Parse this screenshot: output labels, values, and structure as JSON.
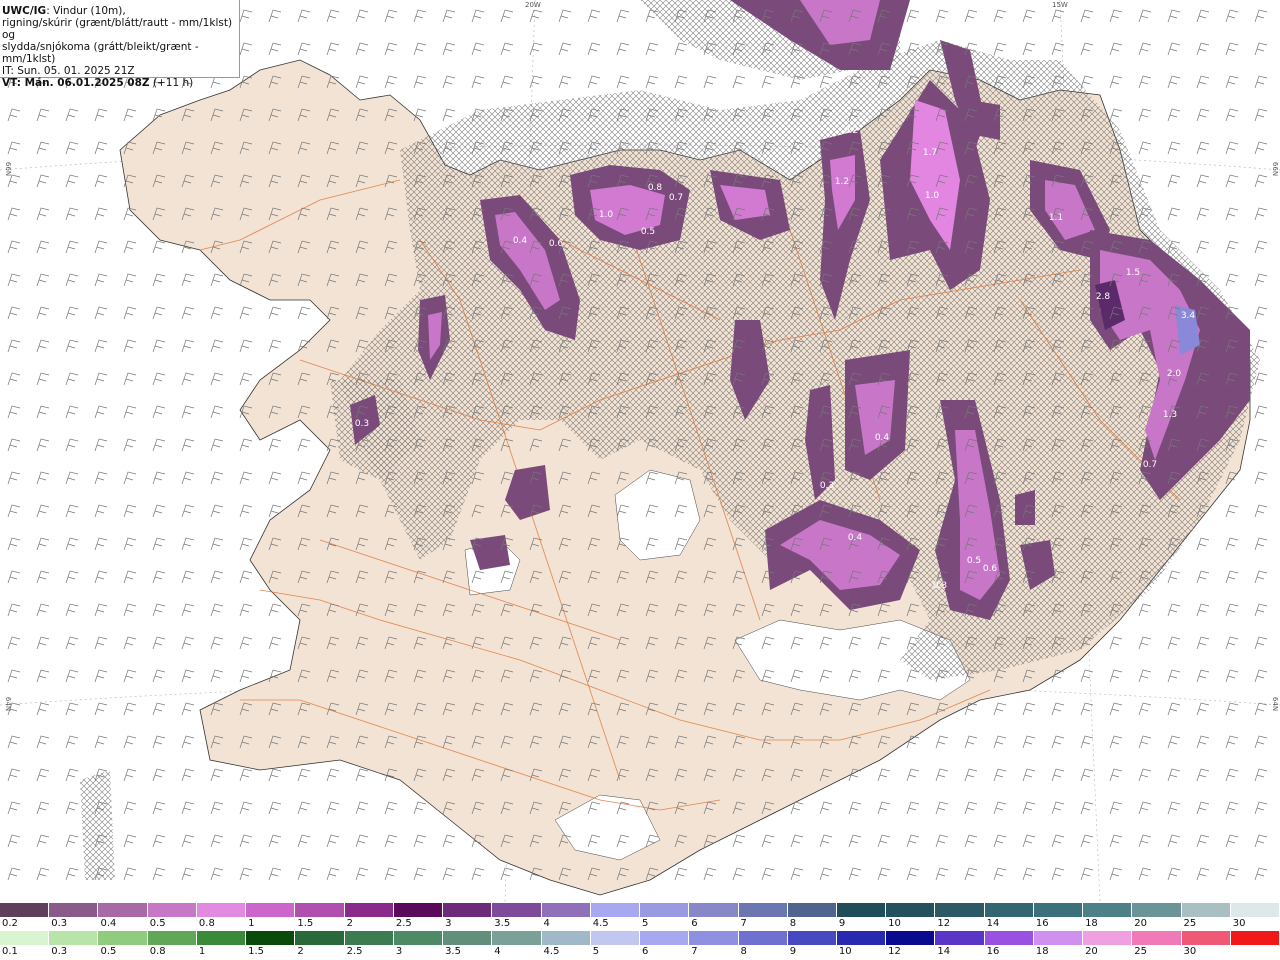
{
  "title": {
    "model": "UWC/IG",
    "line1_rest": ": Vindur (10m),",
    "line2": "rigning/skúrir (grænt/blátt/rautt - mm/1klst) og",
    "line3": "slydda/snjókoma (grátt/bleikt/grænt - mm/1klst)",
    "issue": "IT: Sun. 05. 01. 2025 21Z",
    "valid": "VT: Mán. 06.01.2025 08Z",
    "lead": "(+11 h)"
  },
  "axes": {
    "top_20w": "20W",
    "top_15w": "15W",
    "left_66n": "66N",
    "left_64n": "64N",
    "right_66n": "66N",
    "right_64n": "64N"
  },
  "precip_labels": [
    "0.3",
    "0.8",
    "1.0",
    "0.4",
    "0.6",
    "0.5",
    "0.7",
    "1.2",
    "0.2",
    "1.7",
    "1.0",
    "1.1",
    "2.8",
    "1.5",
    "3.4",
    "2.0",
    "1.3",
    "0.7",
    "0.4",
    "0.3",
    "0.5",
    "0.6",
    "0.4",
    "0.3"
  ],
  "legend_snow": {
    "colors": [
      "#5e3f5c",
      "#8a5a8a",
      "#a86aa6",
      "#c678c6",
      "#e28ae2",
      "#cc66cc",
      "#b14fb0",
      "#8a2a8a",
      "#5a0a5a",
      "#6c2a78",
      "#7e4a9a",
      "#9070b8",
      "#a8a8f0",
      "#9a9ae0",
      "#8888c8",
      "#6c76b0",
      "#50648e",
      "#1f4e5a",
      "#23525c",
      "#2b5a66",
      "#336670",
      "#3c707a",
      "#4e8088",
      "#6a9498",
      "#a9bfc2",
      "#dfe8e8"
    ],
    "ticks": [
      "0.2",
      "0.3",
      "0.4",
      "0.5",
      "0.8",
      "1",
      "1.5",
      "2",
      "2.5",
      "3",
      "3.5",
      "4",
      "4.5",
      "5",
      "6",
      "7",
      "8",
      "9",
      "10",
      "12",
      "14",
      "16",
      "18",
      "20",
      "25",
      "30"
    ]
  },
  "legend_rain": {
    "colors": [
      "#d8f4d0",
      "#b8e4a8",
      "#90cc80",
      "#60a858",
      "#3a8a3a",
      "#0a4a0a",
      "#2a6a3a",
      "#3c7c50",
      "#4e8a66",
      "#628e7c",
      "#7aa098",
      "#a0b8c8",
      "#c0c8f0",
      "#a8a8f0",
      "#9090e0",
      "#7070d0",
      "#4848c0",
      "#2828b0",
      "#0a0a90",
      "#5a36c8",
      "#9a50e0",
      "#d090f0",
      "#f0a0e0",
      "#f07ab8",
      "#f05878",
      "#f01818"
    ],
    "ticks": [
      "0.1",
      "0.3",
      "0.5",
      "0.8",
      "1",
      "1.5",
      "2",
      "2.5",
      "3",
      "3.5",
      "4",
      "4.5",
      "5",
      "6",
      "7",
      "8",
      "9",
      "10",
      "12",
      "14",
      "16",
      "18",
      "20",
      "25",
      "30"
    ]
  }
}
